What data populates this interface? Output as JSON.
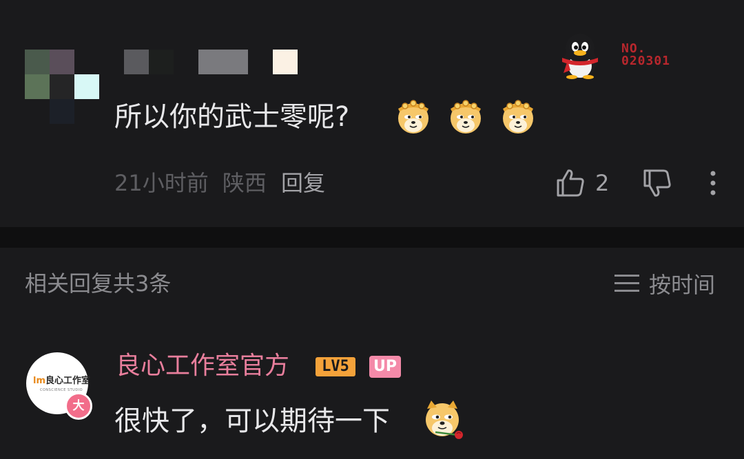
{
  "comment": {
    "text": "所以你的武士零呢?",
    "emoji_icon": "doge-monkey-king-emoji",
    "medal_text": [
      "NO.",
      "020301"
    ],
    "time": "21小时前",
    "location": "陕西",
    "reply_label": "回复",
    "like_count": "2",
    "colors": {
      "text": "#e8e8ea",
      "meta": "#5e5e62",
      "medal": "#b8272d"
    }
  },
  "replies_header": {
    "count_label": "相关回复共3条",
    "sort_label": "按时间"
  },
  "reply": {
    "author": "良心工作室官方",
    "avatar_logo": "良心工作室",
    "avatar_sub": "CONSCIENCE STUDIO",
    "level_badge": "LV5",
    "up_badge": "UP",
    "da_badge": "大",
    "text": "很快了，可以期待一下",
    "emoji_icon": "doge-rose-emoji",
    "colors": {
      "author": "#e87e9c",
      "level": "#f4a23a",
      "up": "#f48aa9"
    }
  }
}
